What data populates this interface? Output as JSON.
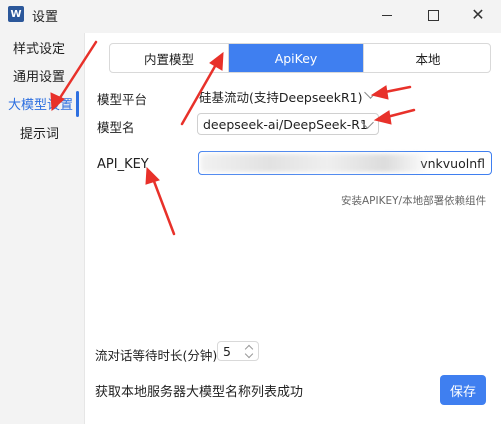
{
  "window": {
    "title": "设置",
    "app_icon_letter": "W",
    "app_icon_color": "#2b579a",
    "close_glyph": "✕"
  },
  "sidebar": {
    "items": [
      {
        "label": "样式设定"
      },
      {
        "label": "通用设置"
      },
      {
        "label": "大模型设置",
        "active": true
      },
      {
        "label": "提示词"
      }
    ]
  },
  "tabs": [
    {
      "label": "内置模型"
    },
    {
      "label": "ApiKey",
      "active": true
    },
    {
      "label": "本地"
    }
  ],
  "form": {
    "platform_label": "模型平台",
    "platform_value": "硅基流动(支持DeepseekR1)",
    "model_label": "模型名",
    "model_value": "deepseek-ai/DeepSeek-R1",
    "api_key_label": "API_KEY",
    "api_key_visible_value": "vnkvuolnfl",
    "hint": "安装APIKEY/本地部署依赖组件",
    "wait_label": "流对话等待时长(分钟)",
    "wait_value": "5"
  },
  "footer": {
    "status": "获取本地服务器大模型名称列表成功",
    "save_label": "保存"
  },
  "colors": {
    "accent": "#3f7ff0",
    "annotation_arrow": "#e8312a"
  }
}
